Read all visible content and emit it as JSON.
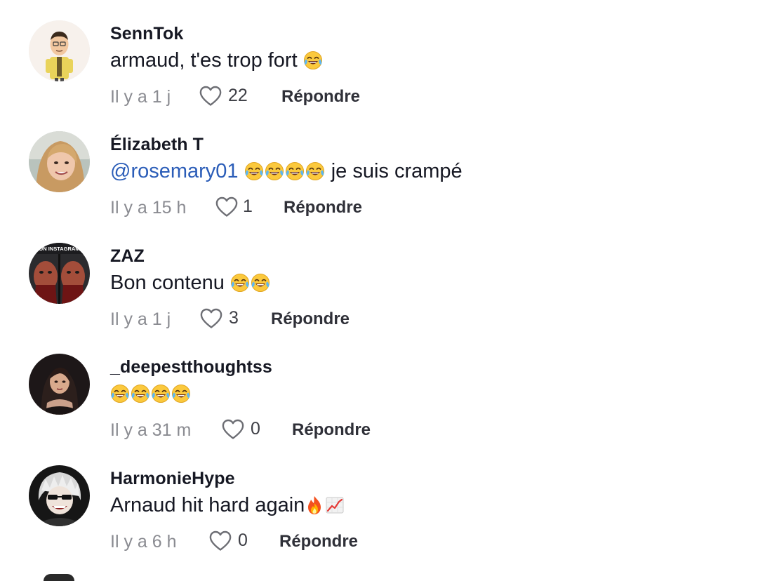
{
  "colors": {
    "mention": "#2b5db8",
    "meta_text": "#8a8b91",
    "primary_text": "#161823"
  },
  "comments": [
    {
      "username": "SennTok",
      "text": "armaud, t'es trop fort",
      "emojis": [
        "face-with-tears-of-joy"
      ],
      "time": "Il y a 1 j",
      "likes": "22",
      "reply": "Répondre",
      "avatar_icon": "cartoon-man-avatar"
    },
    {
      "username": "Élizabeth T",
      "mention": "@rosemary01",
      "text": "je suis crampé",
      "emojis": [
        "face-with-tears-of-joy",
        "face-with-tears-of-joy",
        "face-with-tears-of-joy",
        "face-with-tears-of-joy"
      ],
      "time": "Il y a 15 h",
      "likes": "1",
      "reply": "Répondre",
      "avatar_icon": "woman-photo-avatar"
    },
    {
      "username": "ZAZ",
      "text": "Bon contenu",
      "emojis": [
        "face-with-tears-of-joy",
        "face-with-tears-of-joy"
      ],
      "time": "Il y a 1 j",
      "likes": "3",
      "reply": "Répondre",
      "avatar_icon": "horror-character-avatar",
      "avatar_text": "ON INSTAGRAM"
    },
    {
      "username": "_deepestthoughtss",
      "text": "",
      "emojis": [
        "face-with-tears-of-joy",
        "face-with-tears-of-joy",
        "face-with-tears-of-joy",
        "face-with-tears-of-joy"
      ],
      "time": "Il y a 31 m",
      "likes": "0",
      "reply": "Répondre",
      "avatar_icon": "woman-dark-photo-avatar"
    },
    {
      "username": "HarmonieHype",
      "text": "Arnaud hit hard again",
      "emojis": [
        "fire",
        "chart-increasing"
      ],
      "time": "Il y a 6 h",
      "likes": "0",
      "reply": "Répondre",
      "avatar_icon": "anime-character-avatar"
    }
  ]
}
